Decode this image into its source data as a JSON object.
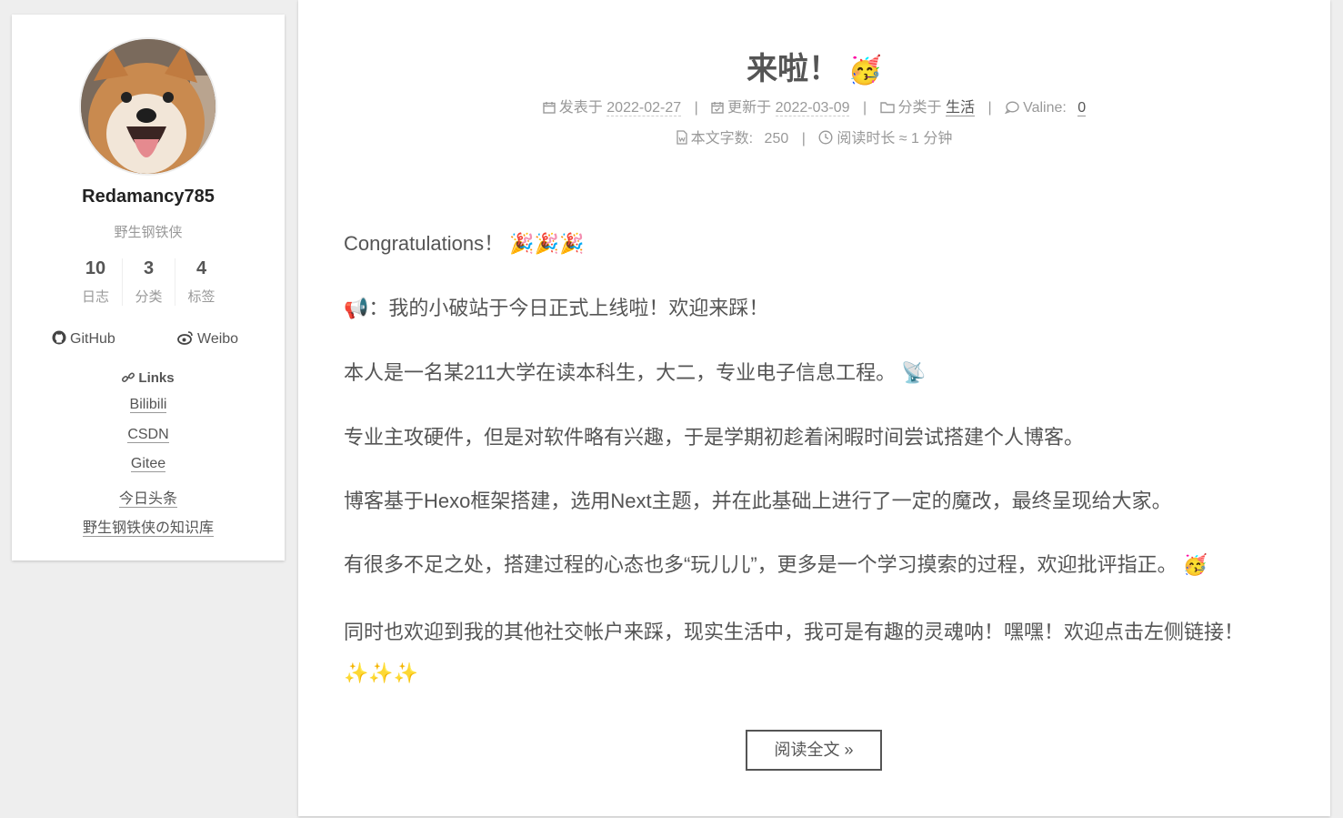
{
  "sidebar": {
    "author_name": "Redamancy785",
    "description": "野生钢铁侠",
    "stats": [
      {
        "count": "10",
        "label": "日志"
      },
      {
        "count": "3",
        "label": "分类"
      },
      {
        "count": "4",
        "label": "标签"
      }
    ],
    "social": {
      "github": "GitHub",
      "weibo": "Weibo"
    },
    "links_title": "Links",
    "links": [
      "Bilibili",
      "CSDN",
      "Gitee",
      "今日头条",
      "野生钢铁侠の知识库"
    ]
  },
  "post": {
    "title": "来啦！",
    "title_emoji": "🥳",
    "meta": {
      "published_label": "发表于",
      "published": "2022-02-27",
      "updated_label": "更新于",
      "updated": "2022-03-09",
      "category_label": "分类于",
      "category": "生活",
      "comments_label": "Valine:",
      "comments": "0",
      "sep": "|",
      "wordcount_label": "本文字数:",
      "wordcount": "250",
      "readtime": "阅读时长 ≈ 1 分钟"
    },
    "paragraphs": [
      {
        "text": "Congratulations！",
        "emoji": "🎉🎉🎉"
      },
      {
        "prefix_emoji": "📢",
        "text": "：我的小破站于今日正式上线啦！欢迎来踩！"
      },
      {
        "text": "本人是一名某211大学在读本科生，大二，专业电子信息工程。",
        "emoji": "📡"
      },
      {
        "text": "专业主攻硬件，但是对软件略有兴趣，于是学期初趁着闲暇时间尝试搭建个人博客。"
      },
      {
        "text": "博客基于Hexo框架搭建，选用Next主题，并在此基础上进行了一定的魔改，最终呈现给大家。"
      },
      {
        "text": "有很多不足之处，搭建过程的心态也多“玩儿儿”，更多是一个学习摸索的过程，欢迎批评指正。",
        "emoji": "🥳"
      },
      {
        "text": "同时也欢迎到我的其他社交帐户来踩，现实生活中，我可是有趣的灵魂呐！嘿嘿！欢迎点击左侧链接！",
        "emoji": "✨✨✨"
      }
    ],
    "read_more": "阅读全文 »"
  }
}
